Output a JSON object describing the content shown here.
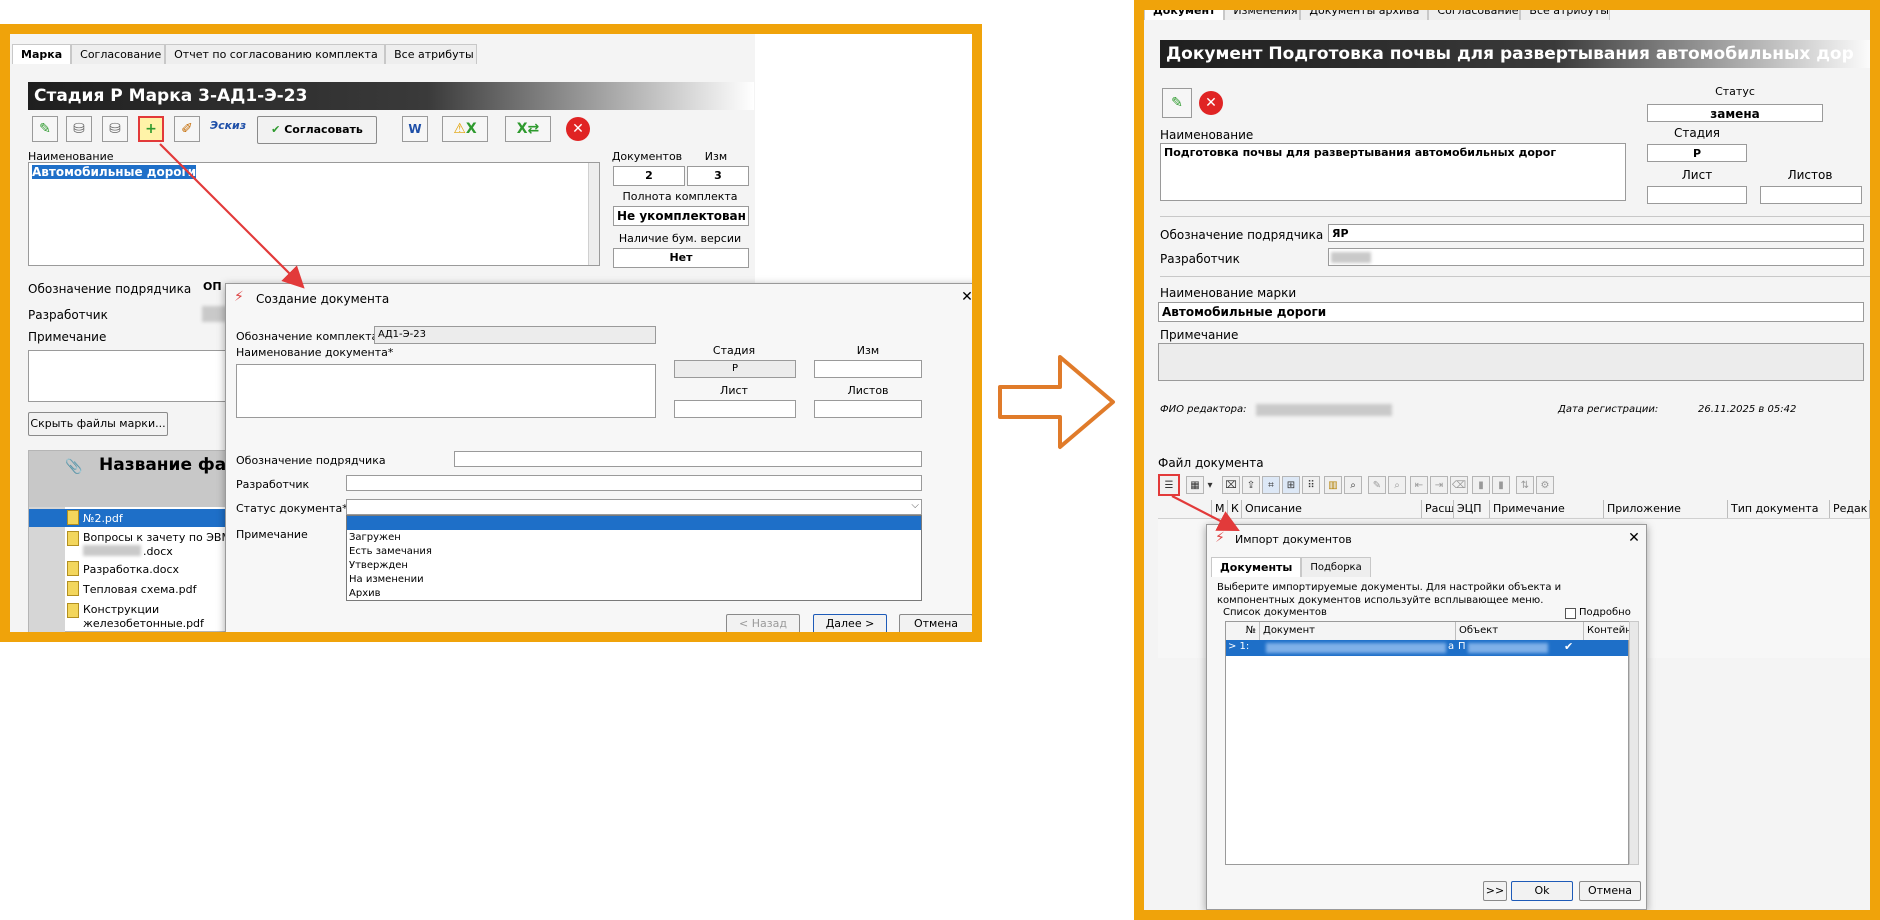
{
  "colors": {
    "frame": "#f0a30a",
    "arrow": "#e07b2a",
    "callout": "#e23a3a",
    "selection": "#1e6fc8"
  },
  "left": {
    "tabs": [
      "Марка",
      "Согласование",
      "Отчет по согласованию комплекта",
      "Все атрибуты"
    ],
    "title": "Стадия Р Марка 3-АД1-Э-23",
    "eskiz": "Эскиз",
    "soglasovat": "Согласовать",
    "name_label": "Наименование",
    "name_value": "Автомобильные дороги",
    "docs_label": "Документов",
    "docs_value": "2",
    "izm_label": "Изм",
    "izm_value": "3",
    "completeness_label": "Полнота комплекта",
    "completeness_value": "Не укомплектован",
    "paper_label": "Наличие бум. версии",
    "paper_value": "Нет",
    "contractor_label": "Обозначение подрядчика",
    "contractor_value": "ОП",
    "developer_label": "Разработчик",
    "note_label": "Примечание",
    "hide_files_button": "Скрыть файлы марки...",
    "files_header": "Название файл",
    "files": [
      "№2.pdf",
      "Вопросы к зачету по ЭВМ и",
      ".docx",
      "Разработка.docx",
      "Тепловая схема.pdf",
      "Конструкции",
      "железобетонные.pdf"
    ],
    "dialog": {
      "title": "Создание документа",
      "kit_label": "Обозначение комплекта",
      "kit_value": "АД1-Э-23",
      "docname_label": "Наименование документа*",
      "stage_label": "Стадия",
      "stage_value": "Р",
      "izm_label": "Изм",
      "sheet_label": "Лист",
      "sheets_label": "Листов",
      "contractor_label": "Обозначение подрядчика",
      "developer_label": "Разработчик",
      "status_label": "Статус документа*",
      "note_label": "Примечание",
      "status_options": [
        "Загружен",
        "Есть замечания",
        "Утвержден",
        "На изменении",
        "Архив"
      ],
      "back_button": "< Назад",
      "next_button": "Далее >",
      "cancel_button": "Отмена"
    }
  },
  "right": {
    "tabs": [
      "Документ",
      "Изменения",
      "Документы архива",
      "Согласование",
      "Все атрибуты"
    ],
    "title": "Документ Подготовка почвы для развертывания автомобильных дор",
    "status_label": "Статус",
    "status_value": "замена",
    "name_label": "Наименование",
    "name_value": "Подготовка почвы для развертывания автомобильных дорог",
    "stage_label": "Стадия",
    "stage_value": "Р",
    "sheet_label": "Лист",
    "sheets_label": "Листов",
    "contractor_label": "Обозначение подрядчика",
    "contractor_value": "ЯР",
    "developer_label": "Разработчик",
    "mark_label": "Наименование марки",
    "mark_value": "Автомобильные дороги",
    "note_label": "Примечание",
    "editor_label": "ФИО редактора:",
    "reg_label": "Дата регистрации:",
    "reg_value": "26.11.2025 в 05:42",
    "file_label": "Файл документа",
    "columns": [
      "М",
      "К",
      "Описание",
      "Расш",
      "ЭЦП",
      "Примечание",
      "Приложение",
      "Тип документа",
      "Редак"
    ],
    "dialog": {
      "title": "Импорт документов",
      "tabs": [
        "Документы",
        "Подборка"
      ],
      "instruction": "Выберите импортируемые документы. Для настройки объекта и компонентных документов используйте всплывающее меню.",
      "list_label": "Список документов",
      "detail_label": "Подробно",
      "columns": [
        "№",
        "Документ",
        "Объект",
        "Контейнер"
      ],
      "row_num": "> 1:",
      "row_doc_tail": "а",
      "row_obj": "П",
      "row_check": "✔",
      "more_button": ">>",
      "ok_button": "Ok",
      "cancel_button": "Отмена"
    }
  }
}
